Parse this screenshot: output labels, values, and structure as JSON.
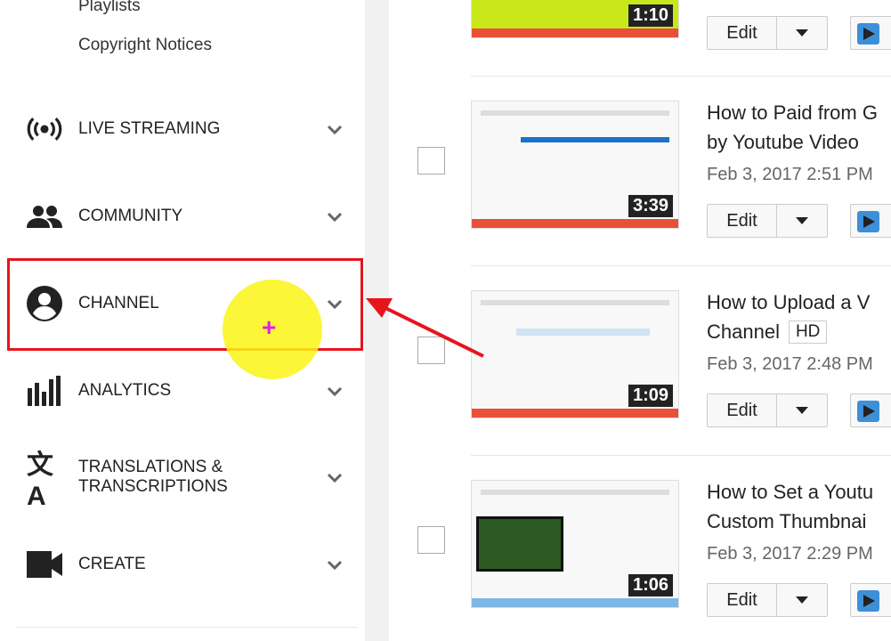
{
  "sidebar": {
    "sub_items": [
      "Playlists",
      "Copyright Notices"
    ],
    "items": [
      {
        "label": "LIVE STREAMING",
        "icon": "live-streaming-icon"
      },
      {
        "label": "COMMUNITY",
        "icon": "community-icon"
      },
      {
        "label": "CHANNEL",
        "icon": "channel-icon",
        "highlighted": true
      },
      {
        "label": "ANALYTICS",
        "icon": "analytics-icon"
      },
      {
        "label": "TRANSLATIONS & TRANSCRIPTIONS",
        "icon": "translate-icon"
      },
      {
        "label": "CREATE",
        "icon": "create-icon"
      }
    ]
  },
  "cursor_symbol": "+",
  "videos": [
    {
      "title1": "",
      "title2": "",
      "date": "",
      "duration": "1:10",
      "bar_color": "#e8503a",
      "edit": "Edit"
    },
    {
      "title1": "How to Paid from G",
      "title2": "by Youtube Video",
      "date": "Feb 3, 2017 2:51 PM",
      "duration": "3:39",
      "bar_color": "#e8503a",
      "edit": "Edit"
    },
    {
      "title1": "How to Upload a V",
      "title2": "Channel",
      "badge": "HD",
      "date": "Feb 3, 2017 2:48 PM",
      "duration": "1:09",
      "bar_color": "#e8503a",
      "edit": "Edit"
    },
    {
      "title1": "How to Set a Youtu",
      "title2": "Custom Thumbnai",
      "date": "Feb 3, 2017 2:29 PM",
      "duration": "1:06",
      "bar_color": "#7fb6e6",
      "edit": "Edit"
    }
  ],
  "colors": {
    "highlight": "#e8141c",
    "accent_blue": "#3d8fd8"
  }
}
